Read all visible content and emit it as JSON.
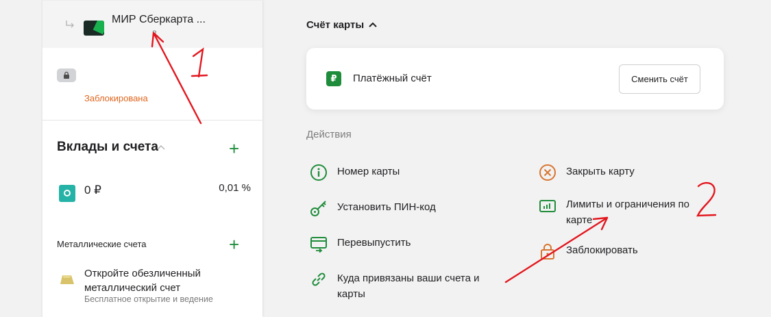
{
  "sidebar": {
    "card": {
      "name": "МИР Сберкарта ...",
      "sub": "3."
    },
    "blocked_status": "Заблокирована",
    "deposits_title": "Вклады и счета",
    "balance": "0 ₽",
    "rate": "0,01 %",
    "metal": {
      "title": "Металлические счета",
      "text": "Откройте обезличенный металлический счет",
      "sub": "Бесплатное открытие и ведение"
    }
  },
  "main": {
    "account_header": "Счёт карты",
    "account_name": "Платёжный счёт",
    "change_button": "Сменить счёт",
    "actions_title": "Действия",
    "actions_left": [
      {
        "label": "Номер карты",
        "icon": "info-icon"
      },
      {
        "label": "Установить ПИН-код",
        "icon": "key-icon"
      },
      {
        "label": "Перевыпустить",
        "icon": "reissue-icon"
      },
      {
        "label": "Куда привязаны ваши счета и карты",
        "icon": "link-icon"
      }
    ],
    "actions_right": [
      {
        "label": "Закрыть карту",
        "icon": "close-card-icon"
      },
      {
        "label": "Лимиты и ограничения по карте",
        "icon": "limits-icon"
      },
      {
        "label": "Заблокировать",
        "icon": "lock-icon"
      }
    ]
  },
  "annotations": {
    "label_1": "1",
    "label_2": "2"
  },
  "colors": {
    "accent_green": "#1e8c3a",
    "blocked_orange": "#e0661e",
    "close_orange": "#d8742e",
    "annotation_red": "#e3161e",
    "teal_safe": "#24b3a6",
    "gold": "#d8c36a"
  }
}
